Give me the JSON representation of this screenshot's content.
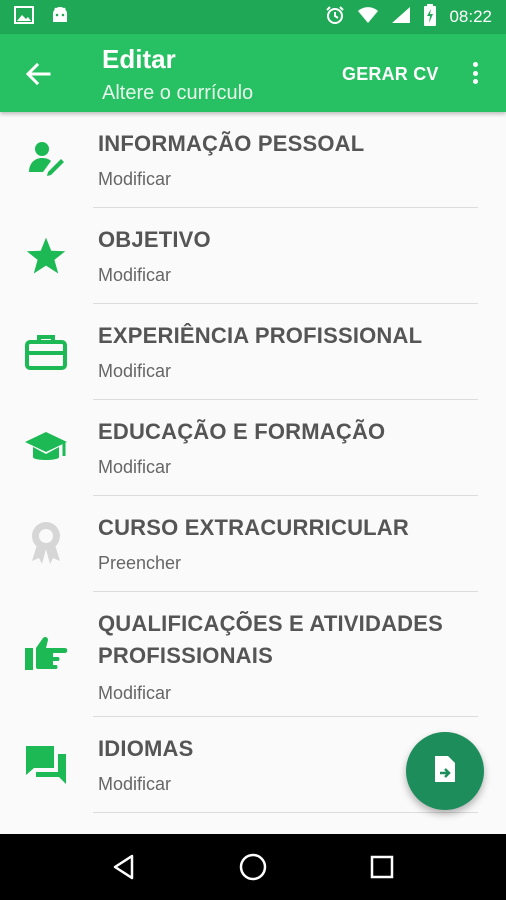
{
  "status_bar": {
    "time": "08:22",
    "icons": [
      "image-icon",
      "android-icon",
      "alarm-icon",
      "wifi-icon",
      "signal-icon",
      "battery-charging-icon"
    ]
  },
  "app_bar": {
    "title": "Editar",
    "subtitle": "Altere o currículo",
    "action_label": "GERAR CV"
  },
  "sections": [
    {
      "title": "INFORMAÇÃO PESSOAL",
      "status": "Modificar",
      "icon": "person-edit-icon"
    },
    {
      "title": "OBJETIVO",
      "status": "Modificar",
      "icon": "star-icon"
    },
    {
      "title": "EXPERIÊNCIA PROFISSIONAL",
      "status": "Modificar",
      "icon": "briefcase-icon"
    },
    {
      "title": "EDUCAÇÃO E FORMAÇÃO",
      "status": "Modificar",
      "icon": "graduation-cap-icon"
    },
    {
      "title": "CURSO EXTRACURRICULAR",
      "status": "Preencher",
      "icon": "award-icon"
    },
    {
      "title": "QUALIFICAÇÕES E ATIVIDADES PROFISSIONAIS",
      "status": "Modificar",
      "icon": "thumb-pointing-icon"
    },
    {
      "title": "IDIOMAS",
      "status": "Modificar",
      "icon": "chat-icon"
    }
  ],
  "colors": {
    "status_bar": "#1fa956",
    "app_bar": "#27c062",
    "icon_active": "#1db954",
    "icon_inactive": "#d6d6d6",
    "fab": "#1d8d5c",
    "title_text": "#555555"
  },
  "fab": {
    "icon": "file-arrow-icon"
  },
  "nav_bar": {
    "icons": [
      "back-triangle-icon",
      "home-circle-icon",
      "recents-square-icon"
    ]
  }
}
